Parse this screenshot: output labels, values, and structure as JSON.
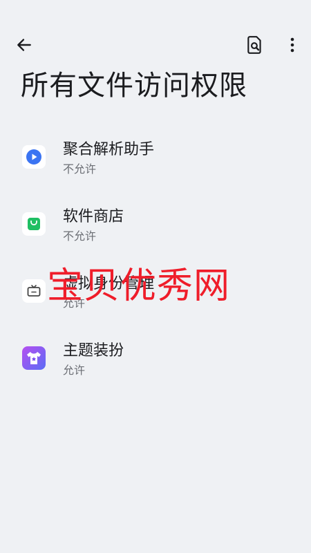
{
  "header": {
    "title": "所有文件访问权限",
    "back_icon": "arrow-left-icon",
    "search_icon": "document-search-icon",
    "more_icon": "more-vertical-icon"
  },
  "apps": [
    {
      "name": "聚合解析助手",
      "status": "不允许",
      "icon": "play-icon",
      "color": "#3b74f2"
    },
    {
      "name": "软件商店",
      "status": "不允许",
      "icon": "shopping-bag-icon",
      "color": "#1fbf63"
    },
    {
      "name": "虚拟身份管理",
      "status": "允许",
      "icon": "tv-icon",
      "color": "#444444"
    },
    {
      "name": "主题装扮",
      "status": "允许",
      "icon": "tshirt-star-icon",
      "color": "#7a4bf0"
    }
  ],
  "watermark": "宝贝优秀网"
}
